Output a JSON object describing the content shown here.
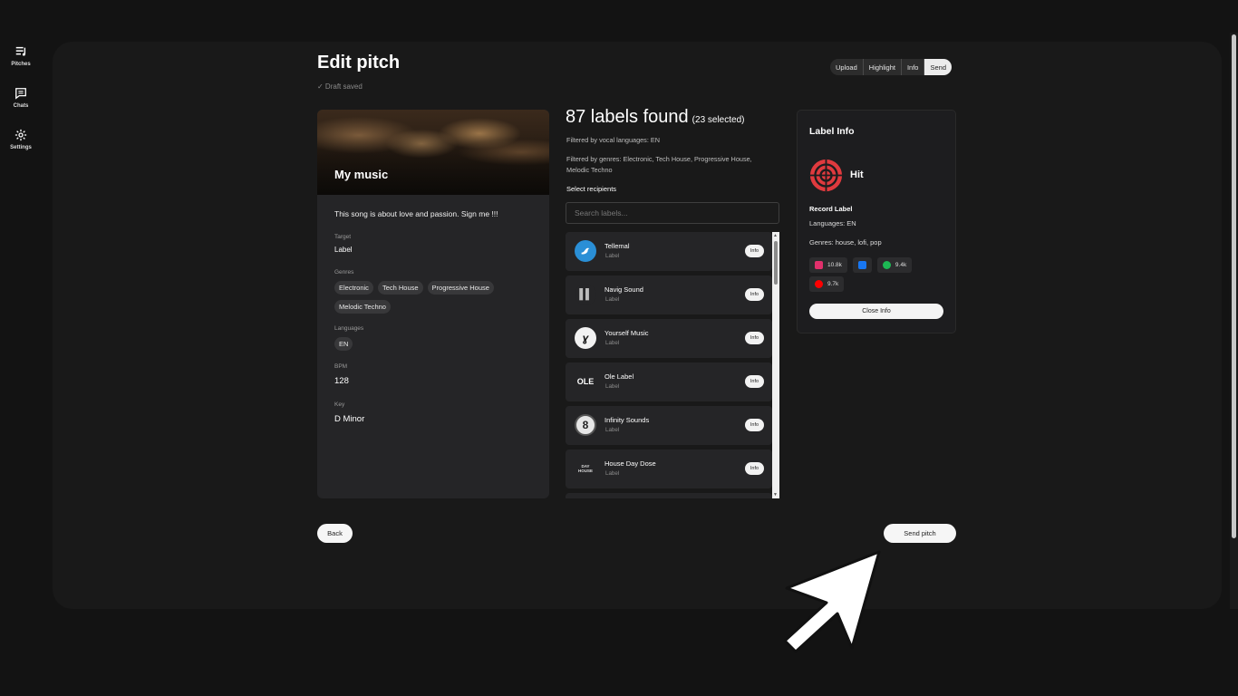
{
  "sidebar": {
    "items": [
      {
        "label": "Pitches",
        "icon": "playlist-icon"
      },
      {
        "label": "Chats",
        "icon": "chat-icon"
      },
      {
        "label": "Settings",
        "icon": "gear-icon"
      }
    ]
  },
  "header": {
    "title": "Edit pitch",
    "draft_status": "✓ Draft saved",
    "steps": [
      "Upload",
      "Highlight",
      "Info",
      "Send"
    ],
    "active_step": "Send"
  },
  "music": {
    "cover_title": "My music",
    "description": "This song is about love and passion. Sign me !!!",
    "target_label": "Target",
    "target_value": "Label",
    "genres_label": "Genres",
    "genres": [
      "Electronic",
      "Tech House",
      "Progressive House",
      "Melodic Techno"
    ],
    "languages_label": "Languages",
    "languages": [
      "EN"
    ],
    "bpm_label": "BPM",
    "bpm_value": "128",
    "key_label": "Key",
    "key_value": "D Minor"
  },
  "results": {
    "count_text": "87 labels found",
    "selected_text": "(23 selected)",
    "filter_languages": "Filtered by vocal languages: EN",
    "filter_genres": "Filtered by genres: Electronic, Tech House, Progressive House, Melodic Techno",
    "select_recipients": "Select recipients",
    "search_placeholder": "Search labels...",
    "info_button_label": "Info",
    "labels": [
      {
        "name": "Tellemal",
        "type": "Label",
        "avatar_text": "",
        "avatar_bg": "#2a8fd6",
        "avatar_color": "#fff"
      },
      {
        "name": "Navig Sound",
        "type": "Label",
        "avatar_text": "▌▌",
        "avatar_bg": "#252527",
        "avatar_color": "#aaa"
      },
      {
        "name": "Yourself Music",
        "type": "Label",
        "avatar_text": "ɣ",
        "avatar_bg": "#f2f2f2",
        "avatar_color": "#111"
      },
      {
        "name": "Ole Label",
        "type": "Label",
        "avatar_text": "OLE",
        "avatar_bg": "#252527",
        "avatar_color": "#fff"
      },
      {
        "name": "Infinity Sounds",
        "type": "Label",
        "avatar_text": "8",
        "avatar_bg": "#e6e6e6",
        "avatar_color": "#222"
      },
      {
        "name": "House Day Dose",
        "type": "Label",
        "avatar_text": "DAY HOUSE",
        "avatar_bg": "#252527",
        "avatar_color": "#ddd"
      }
    ]
  },
  "label_info": {
    "title": "Label Info",
    "name": "Hit",
    "type": "Record Label",
    "languages": "Languages: EN",
    "genres": "Genres: house, lofi, pop",
    "stats": [
      {
        "icon": "instagram-icon",
        "value": "10.8k",
        "color": "#e1306c"
      },
      {
        "icon": "facebook-icon",
        "value": "",
        "color": "#1877f2"
      },
      {
        "icon": "spotify-icon",
        "value": "9.4k",
        "color": "#1db954"
      },
      {
        "icon": "youtube-icon",
        "value": "9.7k",
        "color": "#ff0000"
      }
    ],
    "close_label": "Close Info"
  },
  "footer": {
    "back_label": "Back",
    "send_label": "Send pitch"
  }
}
